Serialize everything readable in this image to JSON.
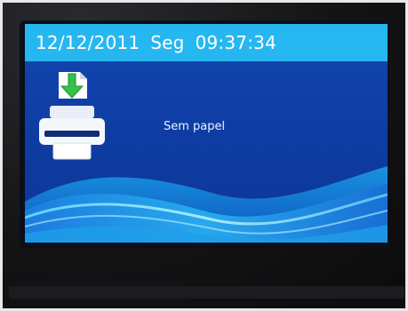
{
  "status_bar": {
    "date": "12/12/2011",
    "weekday": "Seg",
    "time": "09:37:34"
  },
  "main": {
    "status_message": "Sem papel",
    "icon": "printer-paper-load-icon"
  },
  "colors": {
    "status_bar_bg": "#27b7f0",
    "screen_bg": "#0f3ea6",
    "icon_arrow": "#34c24a"
  }
}
